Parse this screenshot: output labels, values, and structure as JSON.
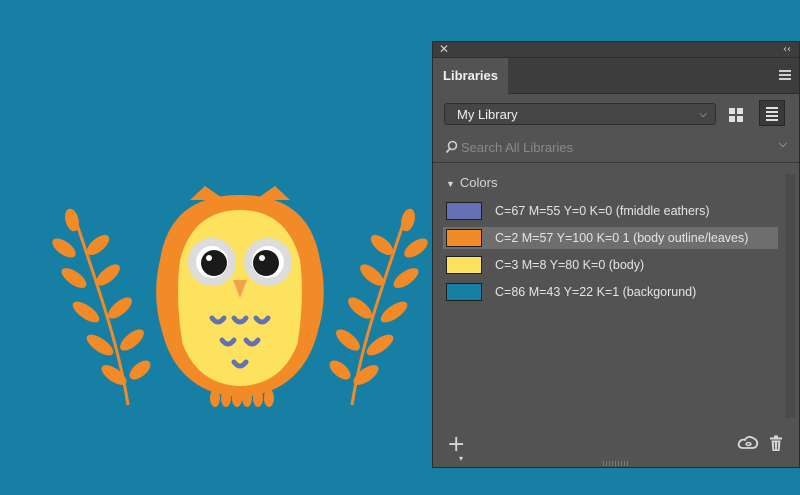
{
  "panel": {
    "tab_label": "Libraries",
    "library_select": "My Library",
    "search_placeholder": "Search All Libraries",
    "section_title": "Colors",
    "colors": [
      {
        "label": "C=67 M=55 Y=0 K=0 (fmiddle eathers)",
        "hex": "#6670b5"
      },
      {
        "label": "C=2 M=57 Y=100 K=0 1 (body outline/leaves)",
        "hex": "#f28a27",
        "selected": true
      },
      {
        "label": "C=3 M=8 Y=80 K=0 (body)",
        "hex": "#fde25f"
      },
      {
        "label": "C=86 M=43 Y=22 K=1 (backgorund)",
        "hex": "#177fa4"
      }
    ]
  },
  "icons": {
    "close": "close-icon",
    "collapse": "collapse-icon",
    "menu": "hamburger-menu-icon",
    "grid": "grid-view-icon",
    "list": "list-view-icon",
    "search": "search-icon",
    "add": "plus-icon",
    "creative_cloud": "creative-cloud-icon",
    "trash": "trash-icon"
  }
}
